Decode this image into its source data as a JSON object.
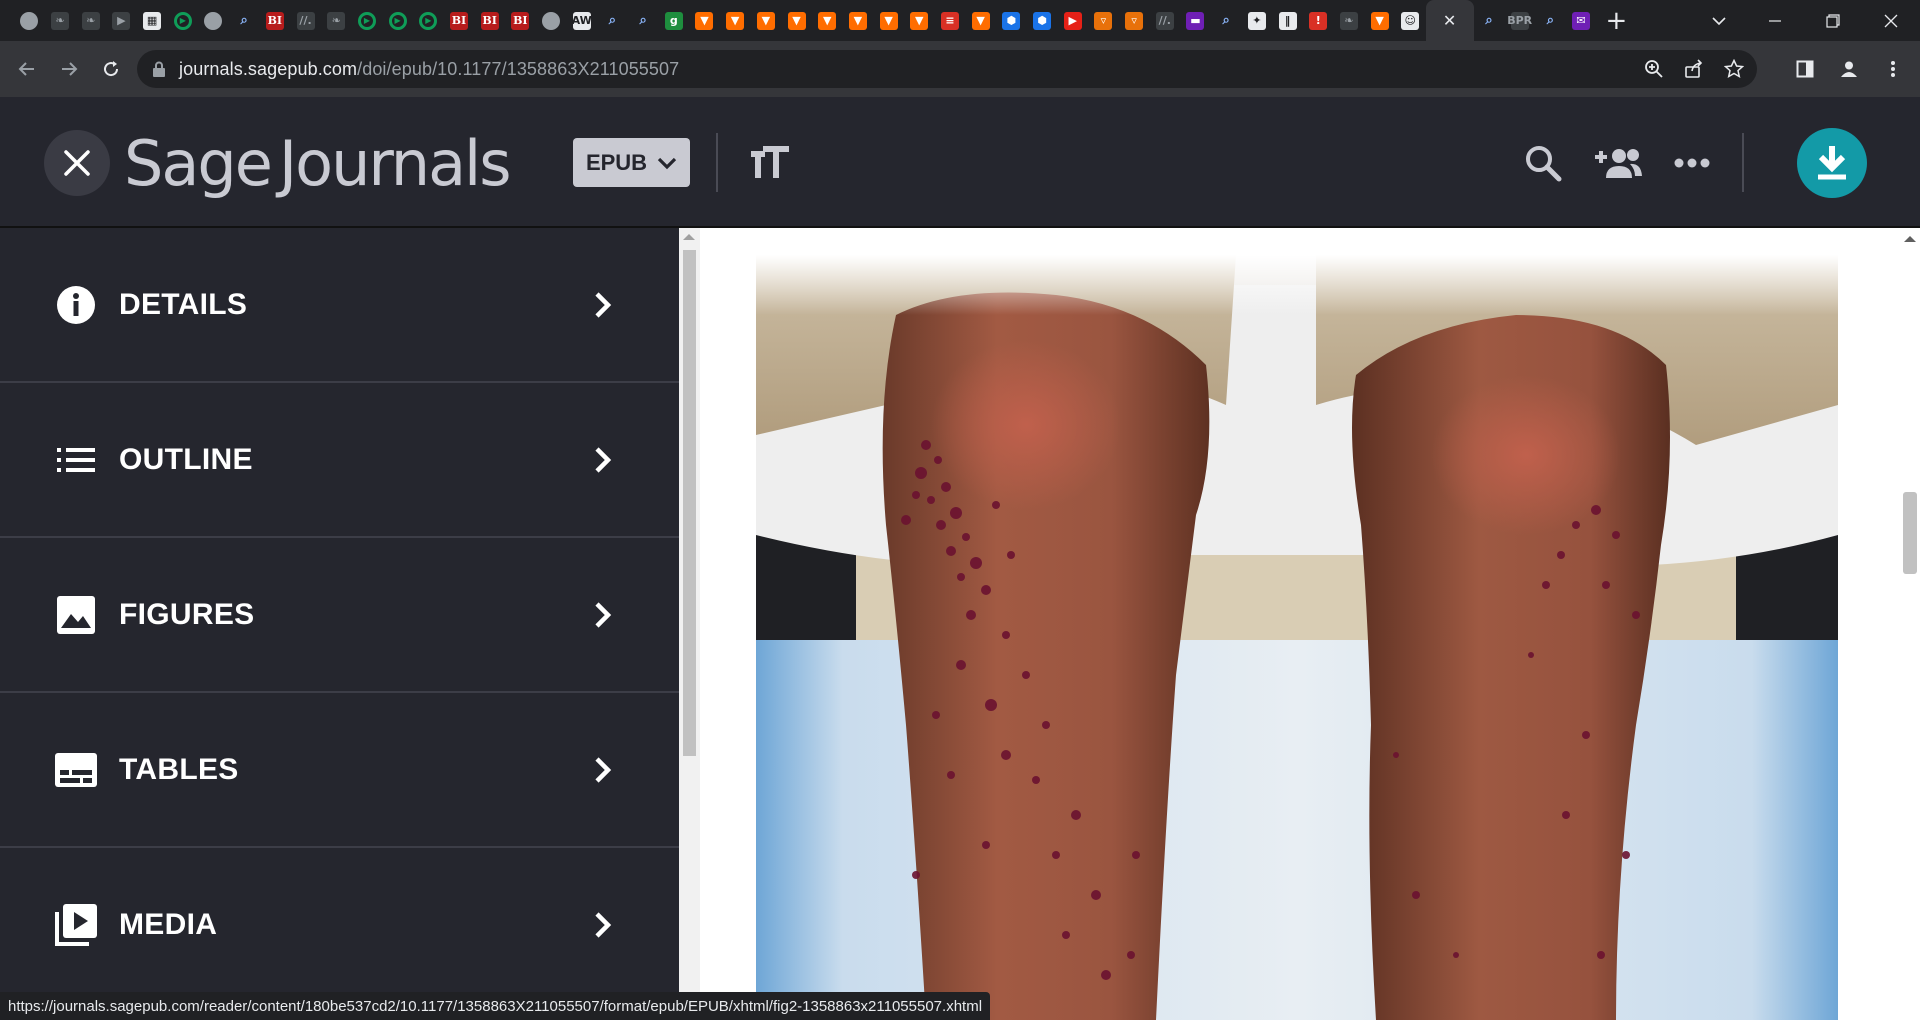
{
  "browser": {
    "tabs": [
      {
        "icon": "globe-icon",
        "glyph": "",
        "style": "f-globe"
      },
      {
        "icon": "feather-icon",
        "glyph": "❧",
        "style": "f-dark"
      },
      {
        "icon": "feather-icon",
        "glyph": "❧",
        "style": "f-dark"
      },
      {
        "icon": "tag-icon",
        "glyph": "▶",
        "style": "f-dark"
      },
      {
        "icon": "pattern-icon",
        "glyph": "▦",
        "style": "f-white"
      },
      {
        "icon": "play-icon",
        "glyph": "▶",
        "style": "f-play"
      },
      {
        "icon": "globe-icon",
        "glyph": "",
        "style": "f-globe"
      },
      {
        "icon": "search-icon",
        "glyph": "⌕",
        "style": "f-blue"
      },
      {
        "icon": "bi-icon",
        "glyph": "BI",
        "style": "f-bi"
      },
      {
        "icon": "slash-icon",
        "glyph": "//.",
        "style": "f-dark"
      },
      {
        "icon": "feather-icon",
        "glyph": "❧",
        "style": "f-dark"
      },
      {
        "icon": "play-icon",
        "glyph": "▶",
        "style": "f-play"
      },
      {
        "icon": "play-icon",
        "glyph": "▶",
        "style": "f-play"
      },
      {
        "icon": "play-icon",
        "glyph": "▶",
        "style": "f-play"
      },
      {
        "icon": "bi-icon",
        "glyph": "BI",
        "style": "f-bi"
      },
      {
        "icon": "bi-icon",
        "glyph": "BI",
        "style": "f-bi"
      },
      {
        "icon": "bi-icon",
        "glyph": "BI",
        "style": "f-bi"
      },
      {
        "icon": "globe-icon",
        "glyph": "",
        "style": "f-globe"
      },
      {
        "icon": "news-icon",
        "glyph": "AW",
        "style": "f-white"
      },
      {
        "icon": "search-icon",
        "glyph": "⌕",
        "style": "f-blue"
      },
      {
        "icon": "search-icon",
        "glyph": "⌕",
        "style": "f-blue"
      },
      {
        "icon": "g-icon",
        "glyph": "g",
        "style": "f-green"
      },
      {
        "icon": "bookmark-icon",
        "glyph": "▼",
        "style": "f-bm"
      },
      {
        "icon": "bookmark-icon",
        "glyph": "▼",
        "style": "f-bm"
      },
      {
        "icon": "bookmark-icon",
        "glyph": "▼",
        "style": "f-bm"
      },
      {
        "icon": "bookmark-icon",
        "glyph": "▼",
        "style": "f-bm"
      },
      {
        "icon": "bookmark-icon",
        "glyph": "▼",
        "style": "f-bm"
      },
      {
        "icon": "bookmark-icon",
        "glyph": "▼",
        "style": "f-bm"
      },
      {
        "icon": "bookmark-icon",
        "glyph": "▼",
        "style": "f-bm"
      },
      {
        "icon": "bookmark-icon",
        "glyph": "▼",
        "style": "f-bm"
      },
      {
        "icon": "flag-icon",
        "glyph": "≡",
        "style": "f-red"
      },
      {
        "icon": "bookmark-icon",
        "glyph": "▼",
        "style": "f-bm"
      },
      {
        "icon": "hexagon-icon",
        "glyph": "⬢",
        "style": "f-hex"
      },
      {
        "icon": "hexagon-icon",
        "glyph": "⬢",
        "style": "f-hex"
      },
      {
        "icon": "youtube-icon",
        "glyph": "▶",
        "style": "f-yt"
      },
      {
        "icon": "shield-icon",
        "glyph": "▿",
        "style": "f-shield"
      },
      {
        "icon": "shield-icon",
        "glyph": "▿",
        "style": "f-shield"
      },
      {
        "icon": "slash-icon",
        "glyph": "//.",
        "style": "f-dark"
      },
      {
        "icon": "purple-icon",
        "glyph": "▬",
        "style": "f-purple"
      },
      {
        "icon": "search-icon",
        "glyph": "⌕",
        "style": "f-blue"
      },
      {
        "icon": "crest-icon",
        "glyph": "✦",
        "style": "f-white"
      },
      {
        "icon": "book-icon",
        "glyph": "‖",
        "style": "f-white"
      },
      {
        "icon": "red-pin-icon",
        "glyph": "!",
        "style": "f-red"
      },
      {
        "icon": "feather-icon",
        "glyph": "❧",
        "style": "f-dark"
      },
      {
        "icon": "bookmark-icon",
        "glyph": "▼",
        "style": "f-bm"
      },
      {
        "icon": "portrait-icon",
        "glyph": "☺",
        "style": "f-white"
      },
      {
        "icon": "close-icon",
        "glyph": "✕",
        "style": "",
        "active": true
      },
      {
        "icon": "search-icon",
        "glyph": "⌕",
        "style": "f-blue"
      },
      {
        "icon": "bpr-icon",
        "glyph": "BPR",
        "style": "f-dark"
      },
      {
        "icon": "search-icon",
        "glyph": "⌕",
        "style": "f-blue"
      },
      {
        "icon": "envelope-icon",
        "glyph": "✉",
        "style": "f-purple"
      }
    ],
    "new_tab_glyph": "+",
    "url_host": "journals.sagepub.com",
    "url_path": "/doi/epub/10.1177/1358863X211055507",
    "status_url": "https://journals.sagepub.com/reader/content/180be537cd2/10.1177/1358863X211055507/format/epub/EPUB/xhtml/fig2-1358863x211055507.xhtml"
  },
  "reader": {
    "logo_word1": "Sage",
    "logo_word2": "Journals",
    "format_label": "EPUB",
    "accent_color": "#139aa7",
    "header_icons": [
      "search-icon",
      "add-people-icon",
      "more-icon"
    ]
  },
  "sidebar": {
    "items": [
      {
        "label": "DETAILS",
        "icon": "info-icon"
      },
      {
        "label": "OUTLINE",
        "icon": "list-icon"
      },
      {
        "label": "FIGURES",
        "icon": "image-icon"
      },
      {
        "label": "TABLES",
        "icon": "table-icon"
      },
      {
        "label": "MEDIA",
        "icon": "video-icon"
      }
    ]
  }
}
